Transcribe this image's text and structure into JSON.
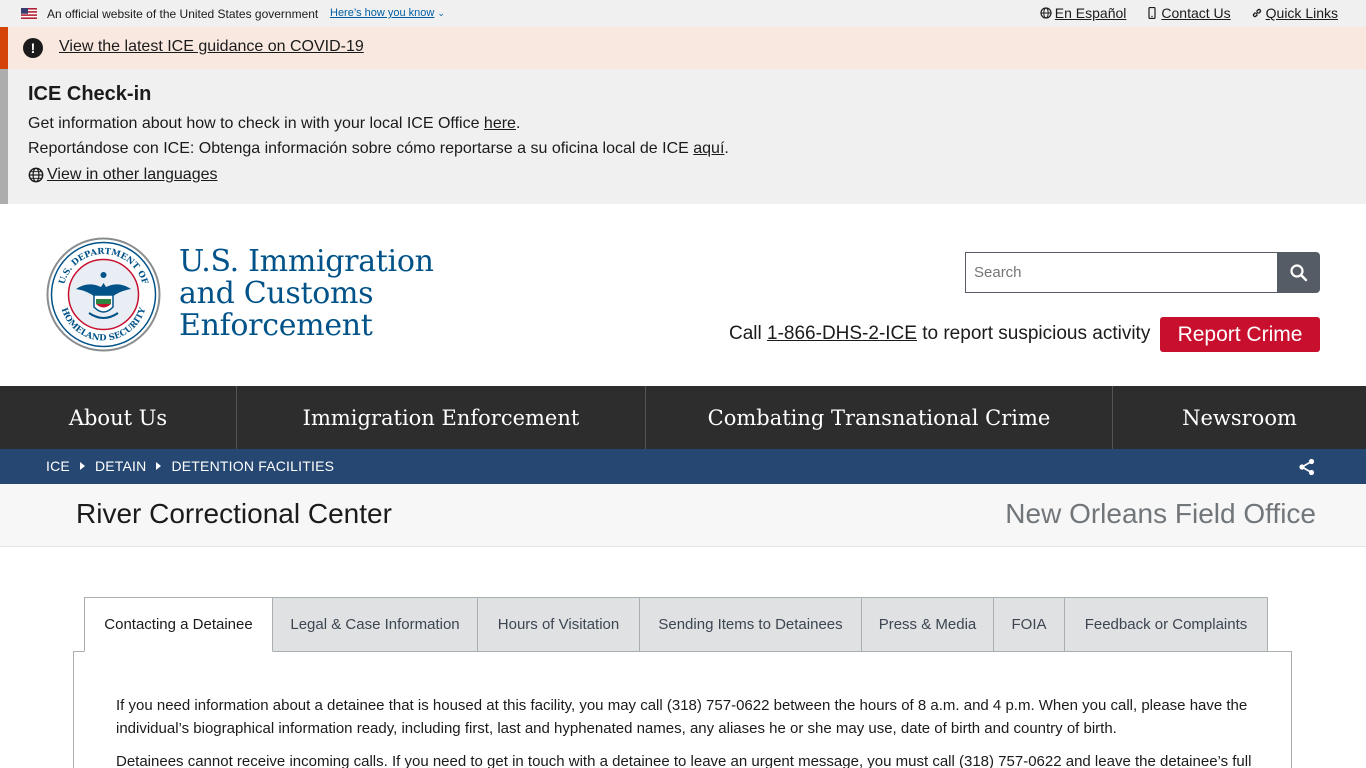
{
  "gov_banner": {
    "official_text": "An official website of the United States government",
    "how_you_know": "Here’s how you know",
    "links": [
      "En Español",
      "Contact Us",
      "Quick Links"
    ]
  },
  "alert": {
    "link_text": "View the latest ICE guidance on COVID-19",
    "accent_color": "#d54309"
  },
  "checkin": {
    "title": "ICE Check-in",
    "line1_text": "Get information about how to check in with your local ICE Office ",
    "line1_link": "here",
    "line1_end": ".",
    "line2_text": "Reportándose con ICE: Obtenga información sobre cómo reportarse a su oficina local de ICE ",
    "line2_link": "aquí",
    "line2_end": ".",
    "languages_link": "View in other languages"
  },
  "header": {
    "agency_line1": "U.S. Immigration",
    "agency_line2": "and Customs",
    "agency_line3": "Enforcement",
    "seal_top_text": "U.S. DEPARTMENT OF",
    "seal_bottom_text": "HOMELAND SECURITY",
    "search_placeholder": "Search",
    "call_prefix": "Call ",
    "call_number": "1-866-DHS-2-ICE",
    "call_suffix": " to report suspicious activity",
    "report_button": "Report Crime",
    "brand_color": "#005288",
    "report_color": "#c8102e"
  },
  "nav": {
    "items": [
      "About Us",
      "Immigration Enforcement",
      "Combating Transnational Crime",
      "Newsroom"
    ]
  },
  "breadcrumb": {
    "items": [
      "ICE",
      "DETAIN",
      "DETENTION FACILITIES"
    ]
  },
  "page": {
    "title": "River Correctional Center",
    "field_office": "New Orleans Field Office"
  },
  "tabs": {
    "items": [
      "Contacting a Detainee",
      "Legal & Case Information",
      "Hours of Visitation",
      "Sending Items to Detainees",
      "Press & Media",
      "FOIA",
      "Feedback or Complaints"
    ],
    "active_index": 0
  },
  "content": {
    "paragraph1": "If you need information about a detainee that is housed at this facility, you may call (318) 757-0622 between the hours of 8 a.m. and 4 p.m. When you call, please have the individual’s biographical information ready, including first, last and hyphenated names, any aliases he or she may use, date of birth and country of birth.",
    "paragraph2": "Detainees cannot receive incoming calls. If you need to get in touch with a detainee to leave an urgent message, you must call (318) 757-0622 and leave the detainee’s full"
  }
}
